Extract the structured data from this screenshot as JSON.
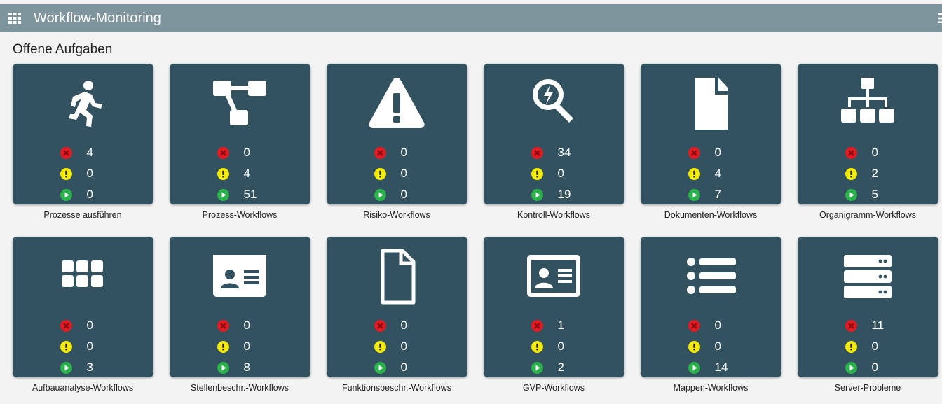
{
  "header": {
    "title": "Workflow-Monitoring",
    "app_icon": "grid-icon",
    "menu_icon": "hamburger-menu-icon",
    "background_color": "#7f959e"
  },
  "section": {
    "title": "Offene Aufgaben"
  },
  "colors": {
    "card": "#33525f",
    "error": "#e01b24",
    "warning": "#f2ea00",
    "running": "#2bb24c"
  },
  "status_icons": [
    "error-icon",
    "warning-icon",
    "running-icon"
  ],
  "tiles": [
    {
      "label": "Prozesse ausführen",
      "icon": "running-person-icon",
      "error": "4",
      "warning": "0",
      "running": "0"
    },
    {
      "label": "Prozess-Workflows",
      "icon": "process-flow-icon",
      "error": "0",
      "warning": "4",
      "running": "51"
    },
    {
      "label": "Risiko-Workflows",
      "icon": "warning-triangle-icon",
      "error": "0",
      "warning": "0",
      "running": "0"
    },
    {
      "label": "Kontroll-Workflows",
      "icon": "magnifier-bolt-icon",
      "error": "34",
      "warning": "0",
      "running": "19"
    },
    {
      "label": "Dokumenten-Workflows",
      "icon": "document-icon",
      "error": "0",
      "warning": "4",
      "running": "7"
    },
    {
      "label": "Organigramm-Workflows",
      "icon": "org-chart-icon",
      "error": "0",
      "warning": "2",
      "running": "5"
    },
    {
      "label": "Aufbauanalyse-Workflows",
      "icon": "grid-tiles-icon",
      "error": "0",
      "warning": "0",
      "running": "3"
    },
    {
      "label": "Stellenbeschr.-Workflows",
      "icon": "id-card-icon",
      "error": "0",
      "warning": "0",
      "running": "8"
    },
    {
      "label": "Funktionsbeschr.-Workflows",
      "icon": "document-outline-icon",
      "error": "0",
      "warning": "0",
      "running": "0"
    },
    {
      "label": "GVP-Workflows",
      "icon": "id-card-outline-icon",
      "error": "1",
      "warning": "0",
      "running": "2"
    },
    {
      "label": "Mappen-Workflows",
      "icon": "list-icon",
      "error": "0",
      "warning": "0",
      "running": "14"
    },
    {
      "label": "Server-Probleme",
      "icon": "server-icon",
      "error": "11",
      "warning": "0",
      "running": "0"
    }
  ]
}
